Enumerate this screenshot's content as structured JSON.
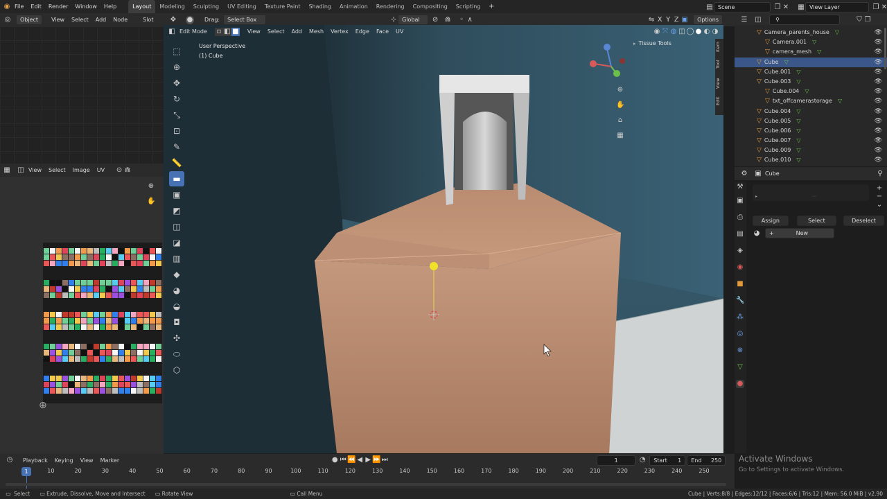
{
  "menu": [
    "File",
    "Edit",
    "Render",
    "Window",
    "Help"
  ],
  "workspaces": [
    {
      "label": "Layout",
      "active": true
    },
    {
      "label": "Modeling",
      "active": false
    },
    {
      "label": "Sculpting",
      "active": false
    },
    {
      "label": "UV Editing",
      "active": false
    },
    {
      "label": "Texture Paint",
      "active": false
    },
    {
      "label": "Shading",
      "active": false
    },
    {
      "label": "Animation",
      "active": false
    },
    {
      "label": "Rendering",
      "active": false
    },
    {
      "label": "Compositing",
      "active": false
    },
    {
      "label": "Scripting",
      "active": false
    }
  ],
  "top_right": {
    "scene": "Scene",
    "view_layer": "View Layer"
  },
  "node_header": {
    "mode": "Object",
    "items": [
      "View",
      "Select",
      "Add",
      "Node"
    ],
    "slot": "Slot"
  },
  "viewport_header": {
    "drag_label": "Drag:",
    "drag_value": "Select Box",
    "orientation": "Global",
    "options": "Options"
  },
  "edit_header": {
    "mode": "Edit Mode",
    "items": [
      "View",
      "Select",
      "Add",
      "Mesh",
      "Vertex",
      "Edge",
      "Face",
      "UV"
    ]
  },
  "viewport": {
    "perspective": "User Perspective",
    "object": "(1) Cube",
    "panel": "Tissue Tools",
    "side_tabs": [
      "Item",
      "Tool",
      "View",
      "Edit"
    ]
  },
  "uv_header": {
    "items": [
      "View",
      "Select",
      "Image",
      "UV"
    ]
  },
  "outliner": [
    {
      "name": "Camera_parents_house",
      "indent": 1,
      "sel": false
    },
    {
      "name": "Camera.001",
      "indent": 2,
      "sel": false
    },
    {
      "name": "camera_mesh",
      "indent": 2,
      "sel": false
    },
    {
      "name": "Cube",
      "indent": 1,
      "sel": true
    },
    {
      "name": "Cube.001",
      "indent": 1,
      "sel": false
    },
    {
      "name": "Cube.003",
      "indent": 1,
      "sel": false
    },
    {
      "name": "Cube.004",
      "indent": 2,
      "sel": false
    },
    {
      "name": "txt_offcamerastorage",
      "indent": 2,
      "sel": false
    },
    {
      "name": "Cube.004",
      "indent": 1,
      "sel": false
    },
    {
      "name": "Cube.005",
      "indent": 1,
      "sel": false
    },
    {
      "name": "Cube.006",
      "indent": 1,
      "sel": false
    },
    {
      "name": "Cube.007",
      "indent": 1,
      "sel": false
    },
    {
      "name": "Cube.009",
      "indent": 1,
      "sel": false
    },
    {
      "name": "Cube.010",
      "indent": 1,
      "sel": false
    }
  ],
  "properties": {
    "object": "Cube",
    "assign": "Assign",
    "select": "Select",
    "deselect": "Deselect",
    "new": "New"
  },
  "timeline": {
    "items": [
      "Playback",
      "Keying",
      "View",
      "Marker"
    ],
    "current_frame": "1",
    "start_label": "Start",
    "start": "1",
    "end_label": "End",
    "end": "250",
    "ticks": [
      "10",
      "20",
      "30",
      "40",
      "50",
      "60",
      "70",
      "80",
      "90",
      "100",
      "110",
      "120",
      "130",
      "140",
      "150",
      "160",
      "170",
      "180",
      "190",
      "200",
      "210",
      "220",
      "230",
      "240",
      "250"
    ],
    "cursor": "1"
  },
  "status": {
    "select": "Select",
    "extrude": "Extrude, Dissolve, Move and Intersect",
    "rotate": "Rotate View",
    "call_menu": "Call Menu",
    "stats": "Cube | Verts:8/8 | Edges:12/12 | Faces:6/6 | Tris:12 | Mem: 56.0 MiB | v2.90"
  },
  "watermark": {
    "title": "Activate Windows",
    "subtitle": "Go to Settings to activate Windows."
  },
  "colors": {
    "accent": "#4772b3",
    "selected_row": "#3b5688",
    "cube": "#c4967a",
    "wall": "#35586a"
  }
}
